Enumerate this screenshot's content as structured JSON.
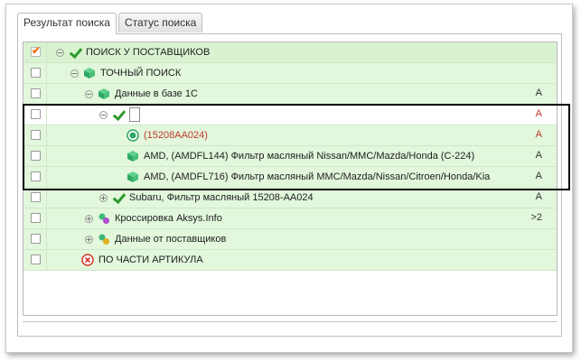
{
  "tabs": [
    {
      "label": "Результат поиска",
      "active": true
    },
    {
      "label": "Статус поиска",
      "active": false
    }
  ],
  "rows": [
    {
      "label": "ПОИСК У ПОСТАВЩИКОВ",
      "checked": true,
      "icon": "check-icon",
      "flag": ""
    },
    {
      "label": "ТОЧНЫЙ ПОИСК",
      "checked": false,
      "icon": "cube-icon",
      "flag": ""
    },
    {
      "label": "Данные в базе 1С",
      "checked": false,
      "icon": "cube-icon",
      "flag": "A"
    },
    {
      "label": "",
      "checked": false,
      "icon": "check-icon",
      "flag": "A"
    },
    {
      "label": "(15208AA024)",
      "checked": false,
      "icon": "dot-icon",
      "flag": "A"
    },
    {
      "label": "AMD, (AMDFL144) Фильтр масляный Nissan/MMC/Mazda/Honda (C-224)",
      "checked": false,
      "icon": "cube-icon",
      "flag": "A"
    },
    {
      "label": "AMD, (AMDFL716) Фильтр масляный MMC/Mazda/Nissan/Citroen/Honda/Kia",
      "checked": false,
      "icon": "cube-icon",
      "flag": "A"
    },
    {
      "label": "Subaru, Фильтр масляный 15208-AA024",
      "checked": false,
      "icon": "check-icon",
      "flag": "A"
    },
    {
      "label": "Кроссировка Aksys.Info",
      "checked": false,
      "icon": "pair-icon",
      "flag": ">2"
    },
    {
      "label": "Данные от поставщиков",
      "checked": false,
      "icon": "pair-icon",
      "flag": ""
    },
    {
      "label": "ПО ЧАСТИ АРТИКУЛА",
      "checked": false,
      "icon": "x-circle-icon",
      "flag": ""
    }
  ],
  "colors": {
    "row_bg": "#e2f7dc",
    "accent_red": "#c0392b",
    "check_green": "#2e9a2e",
    "checkbox_orange": "#e8731c"
  }
}
